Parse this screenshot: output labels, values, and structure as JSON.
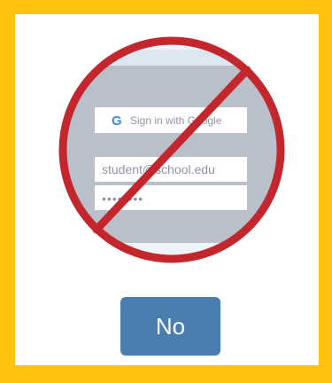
{
  "illustration": {
    "icon": "no-sign-icon",
    "google_button_label": "Sign in with Google",
    "email_value": "student@school.edu",
    "password_mask": "••••••••"
  },
  "actions": {
    "no_label": "No"
  },
  "colors": {
    "frame_border": "#ffc20e",
    "prohibition_red": "#c4262e",
    "button_blue": "#4a7eb1",
    "screen_gray": "#b9c0c9",
    "header_light_blue": "#dbe8f2"
  }
}
